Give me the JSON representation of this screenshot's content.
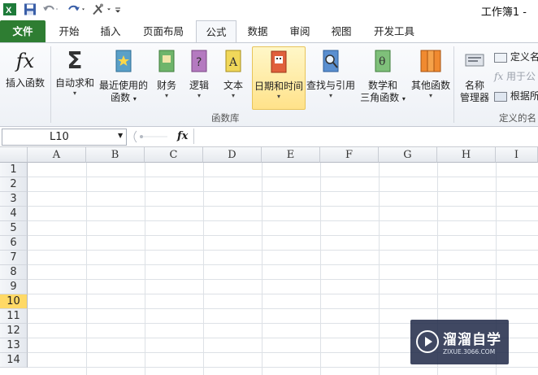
{
  "window": {
    "title": "工作簿1 -"
  },
  "tabs": [
    {
      "label": "文件"
    },
    {
      "label": "开始"
    },
    {
      "label": "插入"
    },
    {
      "label": "页面布局"
    },
    {
      "label": "公式"
    },
    {
      "label": "数据"
    },
    {
      "label": "审阅"
    },
    {
      "label": "视图"
    },
    {
      "label": "开发工具"
    }
  ],
  "ribbon": {
    "insert_function": "插入函数",
    "autosum": "自动求和",
    "recent": [
      "最近使用的",
      "函数"
    ],
    "financial": "财务",
    "logical": "逻辑",
    "text": "文本",
    "datetime": "日期和时间",
    "lookup": "查找与引用",
    "math": [
      "数学和",
      "三角函数"
    ],
    "more": "其他函数",
    "name_manager": [
      "名称",
      "管理器"
    ],
    "define_name": "定义名",
    "use_in_formula": "用于公",
    "create_from": "根据所",
    "group_function_library": "函数库",
    "group_defined_names": "定义的名",
    "fx_symbol": "fx",
    "sigma_symbol": "Σ",
    "text_icon_letter": "A",
    "math_icon_letter": "θ",
    "logical_icon_letter": "?"
  },
  "formula_bar": {
    "name_box": "L10",
    "fx": "fx",
    "formula": ""
  },
  "grid": {
    "columns": [
      "A",
      "B",
      "C",
      "D",
      "E",
      "F",
      "G",
      "H",
      "I"
    ],
    "rows": [
      "1",
      "2",
      "3",
      "4",
      "5",
      "6",
      "7",
      "8",
      "9",
      "10",
      "11",
      "12",
      "13",
      "14"
    ],
    "selected_row": "10"
  },
  "watermark": {
    "title": "溜溜自学",
    "url": "ZIXUE.3066.COM"
  },
  "colors": {
    "file_tab": "#2e7d32",
    "selected_row": "#ffd966",
    "highlight_button": "#ffe28a"
  }
}
